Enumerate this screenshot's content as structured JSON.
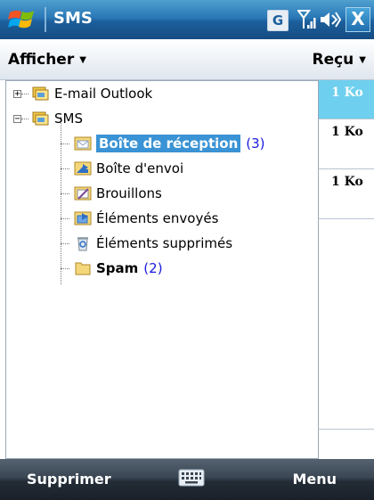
{
  "titlebar": {
    "title": "SMS",
    "network_badge": "G",
    "close_label": "X"
  },
  "header": {
    "left_menu": "Afficher",
    "right_sort": "Reçu"
  },
  "tree": {
    "root1": {
      "label": "E-mail Outlook",
      "expander": "+"
    },
    "root2": {
      "label": "SMS",
      "expander": "−"
    },
    "folders": [
      {
        "label": "Boîte de réception",
        "count": "(3)",
        "icon": "inbox-icon",
        "selected": true
      },
      {
        "label": "Boîte d'envoi",
        "count": "",
        "icon": "outbox-icon"
      },
      {
        "label": "Brouillons",
        "count": "",
        "icon": "drafts-icon"
      },
      {
        "label": "Éléments envoyés",
        "count": "",
        "icon": "sent-items-icon"
      },
      {
        "label": "Éléments supprimés",
        "count": "",
        "icon": "deleted-items-icon"
      },
      {
        "label": "Spam",
        "count": "(2)",
        "icon": "folder-icon",
        "bold": true
      }
    ]
  },
  "message_list": {
    "sizes": [
      "1 Ko",
      "1 Ko",
      "1 Ko"
    ]
  },
  "softkeys": {
    "left": "Supprimer",
    "right": "Menu"
  },
  "colors": {
    "titlebar": "#2a78b6",
    "selection": "#3a93d4",
    "selected_row": "#6ecfee",
    "count": "#1a1adc",
    "softbar": "#2b3540"
  }
}
